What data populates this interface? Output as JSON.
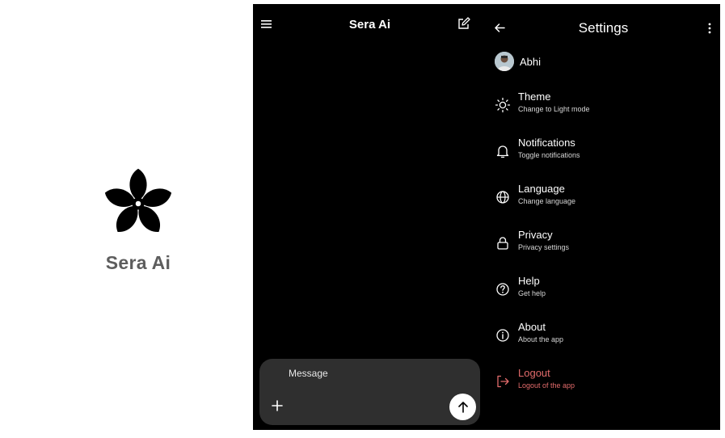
{
  "splash": {
    "app_name": "Sera Ai"
  },
  "chat": {
    "title": "Sera Ai",
    "menu_icon": "hamburger-menu-icon",
    "new_chat_icon": "new-chat-edit-icon",
    "composer": {
      "placeholder": "Message",
      "attach_icon": "plus-icon",
      "send_icon": "arrow-up-icon"
    }
  },
  "settings": {
    "title": "Settings",
    "back_icon": "arrow-left-icon",
    "more_icon": "more-vertical-icon",
    "profile": {
      "name": "Abhi"
    },
    "items": [
      {
        "label": "Theme",
        "sub": "Change to Light mode",
        "icon": "sun-icon"
      },
      {
        "label": "Notifications",
        "sub": "Toggle notifications",
        "icon": "bell-icon"
      },
      {
        "label": "Language",
        "sub": "Change language",
        "icon": "globe-icon"
      },
      {
        "label": "Privacy",
        "sub": "Privacy settings",
        "icon": "lock-icon"
      },
      {
        "label": "Help",
        "sub": "Get help",
        "icon": "help-circle-icon"
      },
      {
        "label": "About",
        "sub": "About the app",
        "icon": "info-icon"
      },
      {
        "label": "Logout",
        "sub": "Logout of the app",
        "icon": "logout-icon"
      }
    ]
  },
  "colors": {
    "background": "#000000",
    "composer": "#2f2f2f",
    "logout": "#e26b6b",
    "splash_text": "#5d5d5d"
  }
}
